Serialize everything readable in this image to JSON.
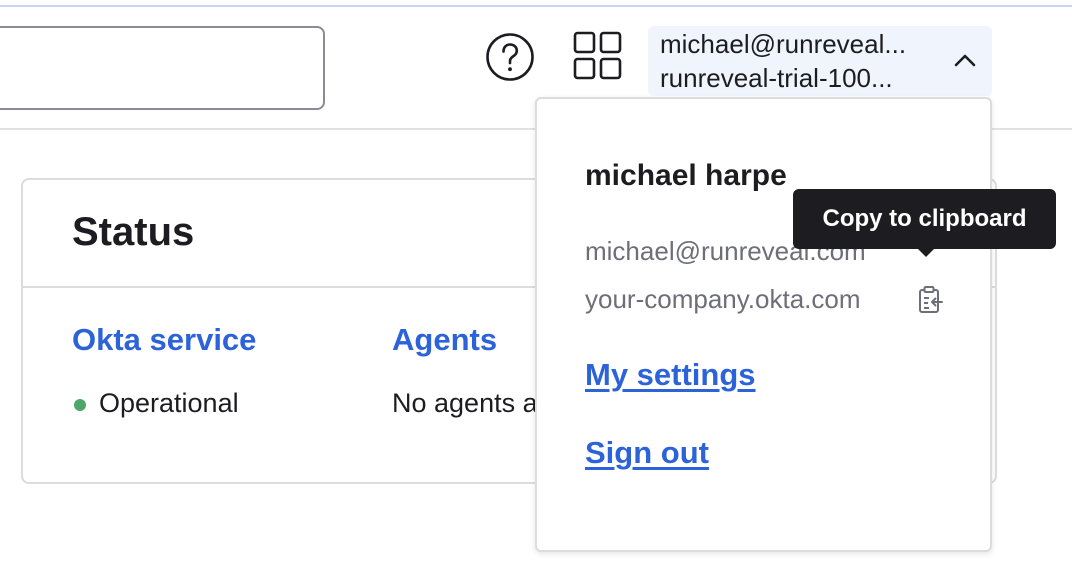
{
  "header": {
    "search": {
      "value": "",
      "placeholder": ""
    },
    "help_icon": "question-circle-icon",
    "apps_icon": "app-grid-icon",
    "user_menu": {
      "email": "michael@runreveal...",
      "org": "runreveal-trial-100...",
      "chevron_icon": "chevron-up-icon"
    }
  },
  "status_card": {
    "title": "Status",
    "okta_service": {
      "heading": "Okta service",
      "status": "Operational",
      "status_color": "#4ea76a"
    },
    "agents": {
      "heading": "Agents",
      "status": "No agents a"
    }
  },
  "user_dropdown": {
    "name": "michael harpe",
    "email": "michael@runreveal.com",
    "org_domain": "your-company.okta.com",
    "copy_icon": "clipboard-copy-icon",
    "my_settings": "My settings",
    "sign_out": "Sign out"
  },
  "tooltip": {
    "text": "Copy to clipboard"
  },
  "colors": {
    "link": "#2c63d8",
    "tooltip_bg": "#1d1d21",
    "user_menu_bg": "#f0f4fd"
  }
}
